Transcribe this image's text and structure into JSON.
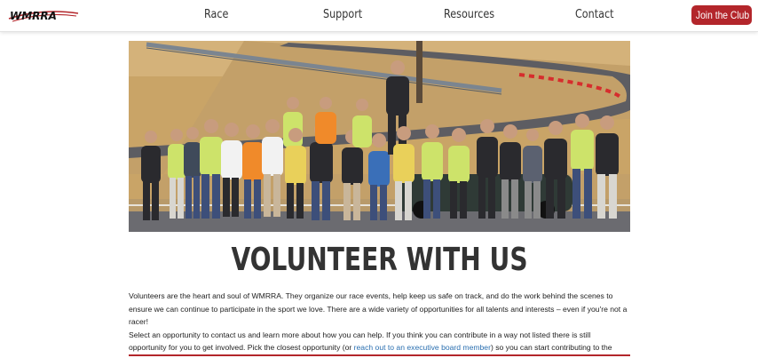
{
  "header": {
    "logo_text": "WMRRA",
    "nav": [
      {
        "label": "Race"
      },
      {
        "label": "Support"
      },
      {
        "label": "Resources"
      },
      {
        "label": "Contact"
      }
    ],
    "cta_label": "Join the Club"
  },
  "main": {
    "heading": "VOLUNTEER WITH US",
    "paragraph_1": "Volunteers are the heart and soul of WMRRA. They organize our race events, help keep us safe on track, and do the work behind the scenes to ensure we can continue to participate in the sport we love. There are a wide variety of opportunities for all talents and interests – even if you're not a racer!",
    "paragraph_2_start": "Select an opportunity to contact us and learn more about how you can help. If you think you can contribute in a way not listed there is still opportunity for you to get involved. Pick the closest opportunity (or ",
    "paragraph_2_link": "reach out to an executive board member",
    "paragraph_2_end": ") so you can start contributing to the club."
  },
  "colors": {
    "brand_red": "#b3262b",
    "link_blue": "#2a6fb0"
  }
}
